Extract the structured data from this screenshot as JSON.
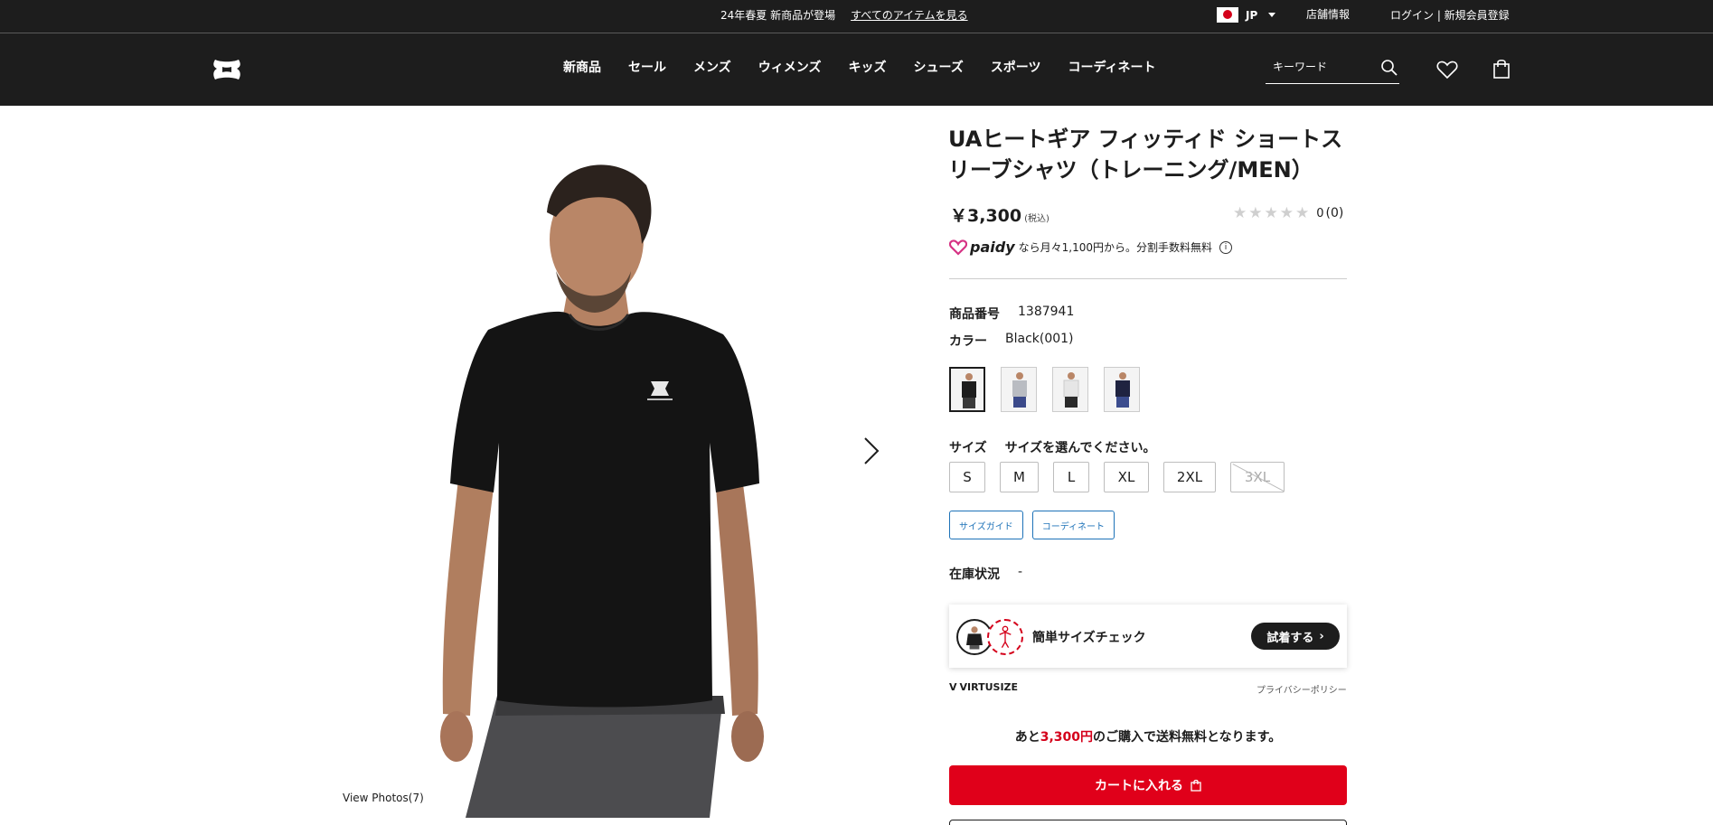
{
  "topbar": {
    "promo_text": "24年春夏 新商品が登場",
    "promo_link": "すべてのアイテムを見る",
    "region": "JP",
    "store_info": "店舗情報",
    "login": "ログイン | 新規会員登録"
  },
  "header": {
    "nav": [
      "新商品",
      "セール",
      "メンズ",
      "ウィメンズ",
      "キッズ",
      "シューズ",
      "スポーツ",
      "コーディネート"
    ],
    "search_placeholder": "キーワード"
  },
  "gallery": {
    "view_photos": "View Photos(7)"
  },
  "product": {
    "title": "UAヒートギア フィッティド ショートスリーブシャツ（トレーニング/MEN）",
    "price": "￥3,300",
    "tax_note": "(税込)",
    "rating_value": "0",
    "rating_count": "(0)",
    "paidy_brand": "paidy",
    "paidy_text": "なら月々1,100円から。分割手数料無料",
    "sku_label": "商品番号",
    "sku_value": "1387941",
    "color_label": "カラー",
    "color_value": "Black(001)",
    "swatches": [
      {
        "name": "Black",
        "shirt": "#1d1d1d",
        "pants": "#3a3a3a"
      },
      {
        "name": "Gray",
        "shirt": "#b9bcc2",
        "pants": "#3b4a8a"
      },
      {
        "name": "White",
        "shirt": "#e6e6e6",
        "pants": "#2a2a2a"
      },
      {
        "name": "Navy",
        "shirt": "#1f2340",
        "pants": "#3c4d8e"
      }
    ],
    "size_label": "サイズ",
    "size_prompt": "サイズを選んでください。",
    "sizes": [
      {
        "label": "S",
        "available": true
      },
      {
        "label": "M",
        "available": true
      },
      {
        "label": "L",
        "available": true
      },
      {
        "label": "XL",
        "available": true
      },
      {
        "label": "2XL",
        "available": true
      },
      {
        "label": "3XL",
        "available": false
      }
    ],
    "size_guide": "サイズガイド",
    "coordinate": "コーディネート",
    "stock_label": "在庫状況",
    "stock_value": "-"
  },
  "virtusize": {
    "text": "簡単サイズチェック",
    "button": "試着する",
    "logo": "VIRTUSIZE",
    "policy": "プライバシーポリシー"
  },
  "shipping": {
    "prefix": "あと",
    "amount": "3,300円",
    "suffix": "のご購入で送料無料となります。"
  },
  "cart": {
    "label": "カートに入れる"
  },
  "colors": {
    "header_bg": "#1d1d1d",
    "cart_red": "#e0001a",
    "link_blue": "#1d72b8"
  }
}
